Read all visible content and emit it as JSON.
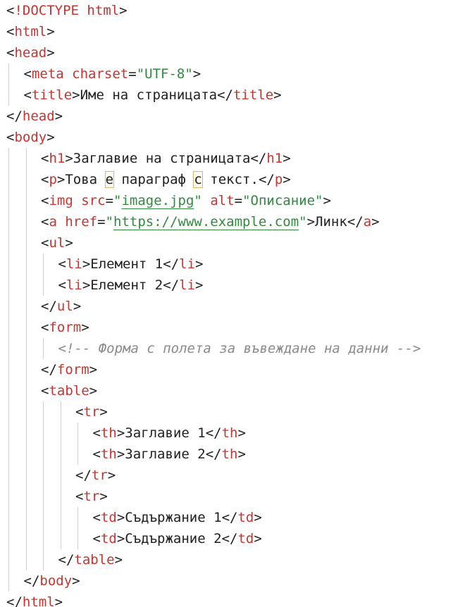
{
  "code": {
    "lines": [
      {
        "indent": 0,
        "tokens": [
          {
            "t": "<",
            "c": "punct"
          },
          {
            "t": "!DOCTYPE html",
            "c": "tag"
          },
          {
            "t": ">",
            "c": "punct"
          }
        ]
      },
      {
        "indent": 0,
        "tokens": [
          {
            "t": "<",
            "c": "punct"
          },
          {
            "t": "html",
            "c": "tag"
          },
          {
            "t": ">",
            "c": "punct"
          }
        ]
      },
      {
        "indent": 0,
        "tokens": [
          {
            "t": "<",
            "c": "punct"
          },
          {
            "t": "head",
            "c": "tag"
          },
          {
            "t": ">",
            "c": "punct"
          }
        ]
      },
      {
        "indent": 1,
        "tokens": [
          {
            "t": "<",
            "c": "punct"
          },
          {
            "t": "meta",
            "c": "tag"
          },
          {
            "t": " ",
            "c": "text"
          },
          {
            "t": "charset",
            "c": "attr"
          },
          {
            "t": "=",
            "c": "punct"
          },
          {
            "t": "\"UTF-8\"",
            "c": "str"
          },
          {
            "t": ">",
            "c": "punct"
          }
        ]
      },
      {
        "indent": 1,
        "tokens": [
          {
            "t": "<",
            "c": "punct"
          },
          {
            "t": "title",
            "c": "tag"
          },
          {
            "t": ">",
            "c": "punct"
          },
          {
            "t": "Име на страницата",
            "c": "text"
          },
          {
            "t": "</",
            "c": "punct"
          },
          {
            "t": "title",
            "c": "tag"
          },
          {
            "t": ">",
            "c": "punct"
          }
        ]
      },
      {
        "indent": 0,
        "tokens": [
          {
            "t": "</",
            "c": "punct"
          },
          {
            "t": "head",
            "c": "tag"
          },
          {
            "t": ">",
            "c": "punct"
          }
        ]
      },
      {
        "indent": 0,
        "tokens": [
          {
            "t": "<",
            "c": "punct"
          },
          {
            "t": "body",
            "c": "tag"
          },
          {
            "t": ">",
            "c": "punct"
          }
        ]
      },
      {
        "indent": 2,
        "tokens": [
          {
            "t": "<",
            "c": "punct"
          },
          {
            "t": "h1",
            "c": "tag"
          },
          {
            "t": ">",
            "c": "punct"
          },
          {
            "t": "Заглавие на страницата",
            "c": "text"
          },
          {
            "t": "</",
            "c": "punct"
          },
          {
            "t": "h1",
            "c": "tag"
          },
          {
            "t": ">",
            "c": "punct"
          }
        ]
      },
      {
        "indent": 2,
        "tokens": [
          {
            "t": "<",
            "c": "punct"
          },
          {
            "t": "p",
            "c": "tag"
          },
          {
            "t": ">",
            "c": "punct"
          },
          {
            "t": "Това ",
            "c": "text"
          },
          {
            "t": "е",
            "c": "hl"
          },
          {
            "t": " параграф ",
            "c": "text"
          },
          {
            "t": "с",
            "c": "hl"
          },
          {
            "t": " текст.",
            "c": "text"
          },
          {
            "t": "</",
            "c": "punct"
          },
          {
            "t": "p",
            "c": "tag"
          },
          {
            "t": ">",
            "c": "punct"
          }
        ]
      },
      {
        "indent": 2,
        "tokens": [
          {
            "t": "<",
            "c": "punct"
          },
          {
            "t": "img",
            "c": "tag"
          },
          {
            "t": " ",
            "c": "text"
          },
          {
            "t": "src",
            "c": "attr"
          },
          {
            "t": "=",
            "c": "punct"
          },
          {
            "t": "\"",
            "c": "str"
          },
          {
            "t": "image.jpg",
            "c": "link"
          },
          {
            "t": "\"",
            "c": "str"
          },
          {
            "t": " ",
            "c": "text"
          },
          {
            "t": "alt",
            "c": "attr"
          },
          {
            "t": "=",
            "c": "punct"
          },
          {
            "t": "\"Описание\"",
            "c": "str"
          },
          {
            "t": ">",
            "c": "punct"
          }
        ]
      },
      {
        "indent": 2,
        "tokens": [
          {
            "t": "<",
            "c": "punct"
          },
          {
            "t": "a",
            "c": "tag"
          },
          {
            "t": " ",
            "c": "text"
          },
          {
            "t": "href",
            "c": "attr"
          },
          {
            "t": "=",
            "c": "punct"
          },
          {
            "t": "\"",
            "c": "str"
          },
          {
            "t": "https://www.example.com",
            "c": "link"
          },
          {
            "t": "\"",
            "c": "str"
          },
          {
            "t": ">",
            "c": "punct"
          },
          {
            "t": "Линк",
            "c": "text"
          },
          {
            "t": "</",
            "c": "punct"
          },
          {
            "t": "a",
            "c": "tag"
          },
          {
            "t": ">",
            "c": "punct"
          }
        ]
      },
      {
        "indent": 2,
        "tokens": [
          {
            "t": "<",
            "c": "punct"
          },
          {
            "t": "ul",
            "c": "tag"
          },
          {
            "t": ">",
            "c": "punct"
          }
        ]
      },
      {
        "indent": 3,
        "tokens": [
          {
            "t": "<",
            "c": "punct"
          },
          {
            "t": "li",
            "c": "tag"
          },
          {
            "t": ">",
            "c": "punct"
          },
          {
            "t": "Елемент 1",
            "c": "text"
          },
          {
            "t": "</",
            "c": "punct"
          },
          {
            "t": "li",
            "c": "tag"
          },
          {
            "t": ">",
            "c": "punct"
          }
        ]
      },
      {
        "indent": 3,
        "tokens": [
          {
            "t": "<",
            "c": "punct"
          },
          {
            "t": "li",
            "c": "tag"
          },
          {
            "t": ">",
            "c": "punct"
          },
          {
            "t": "Елемент 2",
            "c": "text"
          },
          {
            "t": "</",
            "c": "punct"
          },
          {
            "t": "li",
            "c": "tag"
          },
          {
            "t": ">",
            "c": "punct"
          }
        ]
      },
      {
        "indent": 2,
        "tokens": [
          {
            "t": "</",
            "c": "punct"
          },
          {
            "t": "ul",
            "c": "tag"
          },
          {
            "t": ">",
            "c": "punct"
          }
        ]
      },
      {
        "indent": 2,
        "tokens": [
          {
            "t": "<",
            "c": "punct"
          },
          {
            "t": "form",
            "c": "tag"
          },
          {
            "t": ">",
            "c": "punct"
          }
        ]
      },
      {
        "indent": 3,
        "tokens": [
          {
            "t": "<!-- Форма с полета за въвеждане на данни -->",
            "c": "comment"
          }
        ]
      },
      {
        "indent": 2,
        "tokens": [
          {
            "t": "</",
            "c": "punct"
          },
          {
            "t": "form",
            "c": "tag"
          },
          {
            "t": ">",
            "c": "punct"
          }
        ]
      },
      {
        "indent": 2,
        "tokens": [
          {
            "t": "<",
            "c": "punct"
          },
          {
            "t": "table",
            "c": "tag"
          },
          {
            "t": ">",
            "c": "punct"
          }
        ]
      },
      {
        "indent": 4,
        "tokens": [
          {
            "t": "<",
            "c": "punct"
          },
          {
            "t": "tr",
            "c": "tag"
          },
          {
            "t": ">",
            "c": "punct"
          }
        ]
      },
      {
        "indent": 5,
        "tokens": [
          {
            "t": "<",
            "c": "punct"
          },
          {
            "t": "th",
            "c": "tag"
          },
          {
            "t": ">",
            "c": "punct"
          },
          {
            "t": "Заглавие 1",
            "c": "text"
          },
          {
            "t": "</",
            "c": "punct"
          },
          {
            "t": "th",
            "c": "tag"
          },
          {
            "t": ">",
            "c": "punct"
          }
        ]
      },
      {
        "indent": 5,
        "tokens": [
          {
            "t": "<",
            "c": "punct"
          },
          {
            "t": "th",
            "c": "tag"
          },
          {
            "t": ">",
            "c": "punct"
          },
          {
            "t": "Заглавие 2",
            "c": "text"
          },
          {
            "t": "</",
            "c": "punct"
          },
          {
            "t": "th",
            "c": "tag"
          },
          {
            "t": ">",
            "c": "punct"
          }
        ]
      },
      {
        "indent": 4,
        "tokens": [
          {
            "t": "</",
            "c": "punct"
          },
          {
            "t": "tr",
            "c": "tag"
          },
          {
            "t": ">",
            "c": "punct"
          }
        ]
      },
      {
        "indent": 4,
        "tokens": [
          {
            "t": "<",
            "c": "punct"
          },
          {
            "t": "tr",
            "c": "tag"
          },
          {
            "t": ">",
            "c": "punct"
          }
        ]
      },
      {
        "indent": 5,
        "tokens": [
          {
            "t": "<",
            "c": "punct"
          },
          {
            "t": "td",
            "c": "tag"
          },
          {
            "t": ">",
            "c": "punct"
          },
          {
            "t": "Съдържание 1",
            "c": "text"
          },
          {
            "t": "</",
            "c": "punct"
          },
          {
            "t": "td",
            "c": "tag"
          },
          {
            "t": ">",
            "c": "punct"
          }
        ]
      },
      {
        "indent": 5,
        "tokens": [
          {
            "t": "<",
            "c": "punct"
          },
          {
            "t": "td",
            "c": "tag"
          },
          {
            "t": ">",
            "c": "punct"
          },
          {
            "t": "Съдържание 2",
            "c": "text"
          },
          {
            "t": "</",
            "c": "punct"
          },
          {
            "t": "td",
            "c": "tag"
          },
          {
            "t": ">",
            "c": "punct"
          }
        ]
      },
      {
        "indent": 3,
        "tokens": [
          {
            "t": "</",
            "c": "punct"
          },
          {
            "t": "table",
            "c": "tag"
          },
          {
            "t": ">",
            "c": "punct"
          }
        ]
      },
      {
        "indent": 1,
        "tokens": [
          {
            "t": "</",
            "c": "punct"
          },
          {
            "t": "body",
            "c": "tag"
          },
          {
            "t": ">",
            "c": "punct"
          }
        ]
      },
      {
        "indent": 0,
        "tokens": [
          {
            "t": "</",
            "c": "punct"
          },
          {
            "t": "html",
            "c": "tag"
          },
          {
            "t": ">",
            "c": "punct"
          }
        ]
      }
    ]
  },
  "colors": {
    "tag": "#c8342f",
    "string": "#2f8a3f",
    "comment": "#8a8a8a",
    "text": "#1f1f1f",
    "guide": "#d0d0d0",
    "highlight_border": "#d9b76a"
  }
}
